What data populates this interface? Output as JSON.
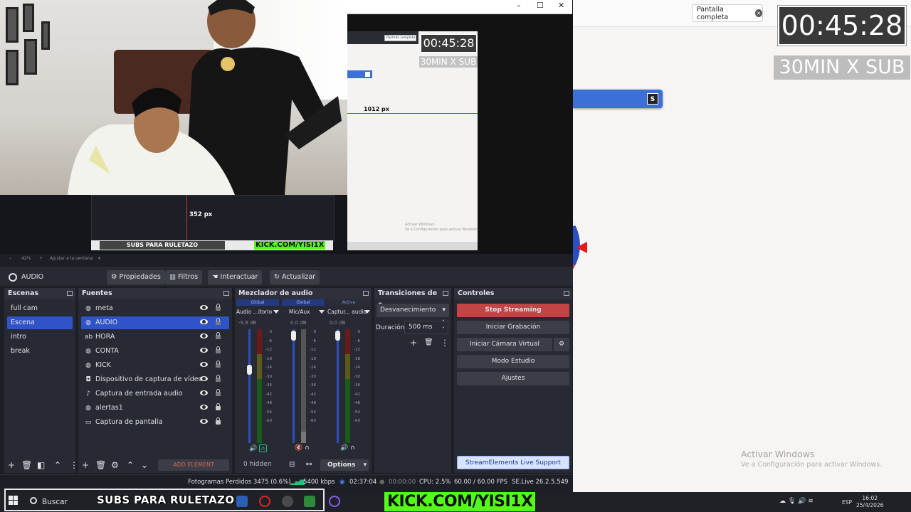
{
  "browser": {
    "fullscreen_label": "Pantalla completa",
    "timer": "00:45:28",
    "sub_label": "30MIN  X SUB",
    "blue_bar_key": "S",
    "activate_windows_title": "Activar Windows",
    "activate_windows_sub": "Ve a Configuración para activar Windows.",
    "colors": {
      "timer_bg": "#393939",
      "accent_blue": "#3c70d6",
      "pointer_red": "#e21b1b"
    }
  },
  "preview": {
    "nested_window_buttons": [
      "–",
      "☐",
      "✕"
    ],
    "nested_fullscreen": "Pantalla completa",
    "nested_timer": "00:45:28",
    "nested_sub": "30MIN  X SUB",
    "measure_horizontal": "1012 px",
    "measure_vertical": "352 px",
    "nested_subs_banner": "SUBS PARA RULETAZO",
    "nested_kick": "KICK.COM/YISI1X",
    "nested_activate": "Activar Windows\nVe a Configuración para activar Windows.",
    "zoom_value": "42%",
    "zoom_fit": "Ajustar a la ventana"
  },
  "context_bar": {
    "source_name": "AUDIO",
    "buttons": [
      "Propiedades",
      "Filtros",
      "Interactuar",
      "Actualizar"
    ]
  },
  "scenes": {
    "title": "Escenas",
    "items": [
      "full cam",
      "Escena",
      "intro",
      "break"
    ],
    "selected": "Escena"
  },
  "sources": {
    "title": "Fuentes",
    "items": [
      {
        "label": "meta",
        "icon": "globe-icon",
        "locked": false
      },
      {
        "label": "AUDIO",
        "icon": "globe-icon",
        "locked": false
      },
      {
        "label": "HORA",
        "icon": "text-icon",
        "locked": false
      },
      {
        "label": "CONTA",
        "icon": "globe-icon",
        "locked": false
      },
      {
        "label": "KICK",
        "icon": "globe-icon",
        "locked": false
      },
      {
        "label": "Dispositivo de captura de vídeo",
        "icon": "camera-icon",
        "locked": false
      },
      {
        "label": "Captura de entrada audio",
        "icon": "mic-icon",
        "locked": false
      },
      {
        "label": "alertas1",
        "icon": "globe-icon",
        "locked": true
      },
      {
        "label": "Captura de pantalla",
        "icon": "monitor-icon",
        "locked": true
      }
    ],
    "selected": "AUDIO",
    "add_element": "ADD ELEMENT"
  },
  "mixer": {
    "title": "Mezclador de audio",
    "channels": [
      {
        "tab": "Global",
        "name": "Audio ...itorio",
        "db": "-5.6 dB"
      },
      {
        "tab": "Global",
        "name": "Mic/Aux",
        "db": "0.0 dB"
      },
      {
        "tab": "Active",
        "name": "Captur... audio",
        "db": "0.0 dB"
      }
    ],
    "scale": [
      "0",
      "-6",
      "-12",
      "-18",
      "-24",
      "-30",
      "-36",
      "-42",
      "-48",
      "-54",
      "-60"
    ],
    "hidden_label": "0 hidden",
    "options_label": "Options"
  },
  "transitions": {
    "title": "Transiciones de e...",
    "selected": "Desvanecimiento",
    "duration_label": "Duración",
    "duration_value": "500 ms"
  },
  "controls": {
    "title": "Controles",
    "stop_streaming": "Stop Streaming",
    "start_recording": "Iniciar Grabación",
    "virtual_camera": "Iniciar Cámara Virtual",
    "studio_mode": "Modo Estudio",
    "settings": "Ajustes",
    "se_support": "StreamElements Live Support"
  },
  "status": {
    "dropped_frames": "Fotogramas Perdidos 3475 (0.6%)",
    "bitrate": "5400 kbps",
    "live_time": "02:37:04",
    "rec_time": "00:00:00",
    "cpu": "CPU: 2.5%",
    "fps": "60.00 / 60.00 FPS",
    "version": "SE.Live 26.2.5.549"
  },
  "taskbar": {
    "search": "Buscar",
    "subs_banner": "SUBS PARA RULETAZO",
    "kick": "KICK.COM/YISI1X",
    "lang": "ESP",
    "time": "16:02",
    "date": "25/4/2026"
  }
}
